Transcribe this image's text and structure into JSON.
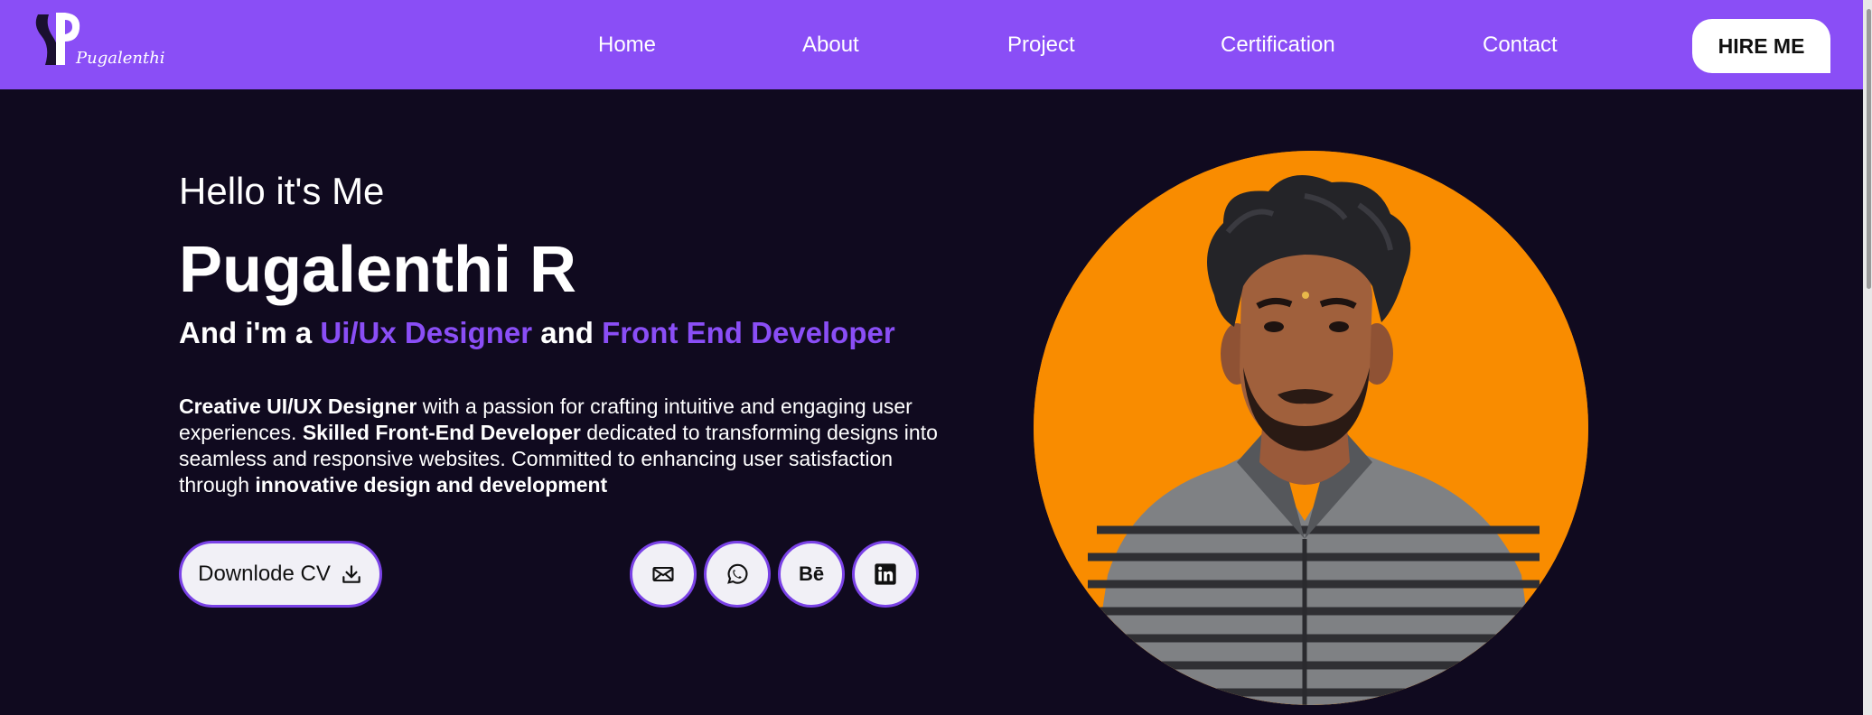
{
  "brand": {
    "logo_text": "Pugalenthi"
  },
  "nav": {
    "items": [
      {
        "label": "Home"
      },
      {
        "label": "About"
      },
      {
        "label": "Project"
      },
      {
        "label": "Certification"
      },
      {
        "label": "Contact"
      }
    ],
    "hire_label": "HIRE ME"
  },
  "hero": {
    "greeting": "Hello it's Me",
    "name": "Pugalenthi R",
    "role_prefix": "And i'm a ",
    "role_1": "Ui/Ux Designer",
    "role_join": " and ",
    "role_2": "Front End Developer",
    "bio": {
      "b1": "Creative UI/UX Designer",
      "t1": " with a passion for crafting intuitive and engaging user experiences. ",
      "b2": "Skilled Front-End Developer",
      "t2": " dedicated to transforming designs into seamless and responsive websites. Committed to enhancing user satisfaction through ",
      "b3": "innovative design and development"
    },
    "cv_label": "Downlode CV",
    "social_icons": [
      "mail-icon",
      "whatsapp-icon",
      "behance-icon",
      "linkedin-icon"
    ],
    "behance_text": "Bē"
  },
  "colors": {
    "nav_bg": "#8a4ef6",
    "page_bg": "#100a1f",
    "accent": "#8a4ef6",
    "portrait_bg": "#f98c00"
  }
}
